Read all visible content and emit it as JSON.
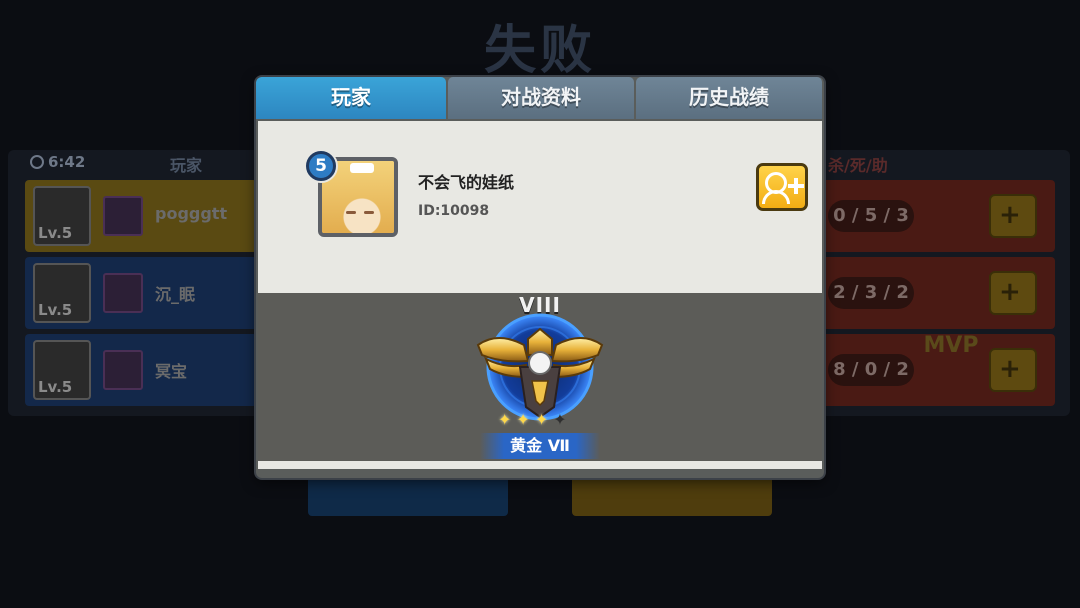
{
  "background": {
    "title": "失败",
    "time": "6:42",
    "header_player": "玩家",
    "header_kda": "杀/死/助",
    "players": [
      {
        "level": "Lv.5",
        "name": "pogggtt"
      },
      {
        "level": "Lv.5",
        "name": "沉_眠"
      },
      {
        "level": "Lv.5",
        "name": "冥宝"
      }
    ],
    "kda": [
      "0 / 5 / 3",
      "2 / 3 / 2",
      "8 / 0 / 2"
    ],
    "mvp": "MVP"
  },
  "tabs": [
    {
      "label": "玩家",
      "active": true
    },
    {
      "label": "对战资料",
      "active": false
    },
    {
      "label": "历史战绩",
      "active": false
    }
  ],
  "profile": {
    "level": "5",
    "name": "不会飞的娃纸",
    "id": "ID:10098"
  },
  "rank": {
    "tier_numeral": "VIII",
    "stars_filled": 3,
    "stars_total": 4,
    "label": "黄金 Ⅶ"
  },
  "colors": {
    "active_tab": "#2d86c0",
    "inactive_tab": "#5b6f80",
    "add_friend": "#f2ad14",
    "rank_banner": "#2a66c6"
  }
}
